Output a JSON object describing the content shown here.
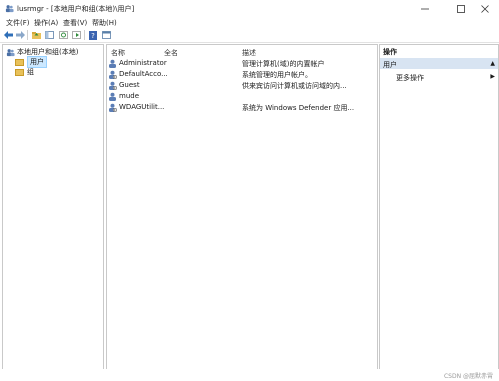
{
  "window": {
    "title": "lusrmgr - [本地用户和组(本地)\\用户]",
    "app_icon": "user-group-icon",
    "min_icon": "minimize-icon",
    "max_icon": "maximize-icon",
    "close_icon": "close-icon"
  },
  "menu": {
    "items": [
      {
        "label": "文件(F)"
      },
      {
        "label": "操作(A)"
      },
      {
        "label": "查看(V)"
      },
      {
        "label": "帮助(H)"
      }
    ]
  },
  "toolbar": {
    "buttons": [
      "back-icon",
      "forward-icon",
      "up-folder-icon",
      "show-hide-tree-icon",
      "refresh-icon",
      "export-list-icon",
      "help-icon",
      "properties-icon"
    ]
  },
  "tree": {
    "root": "本地用户和组(本地)",
    "children": [
      {
        "label": "用户",
        "selected": true
      },
      {
        "label": "组",
        "selected": false
      }
    ]
  },
  "list": {
    "columns": {
      "name": "名称",
      "fullname": "全名",
      "description": "描述"
    },
    "rows": [
      {
        "name": "Administrator",
        "description": "管理计算机(域)的内置帐户"
      },
      {
        "name": "DefaultAcco...",
        "description": "系统管理的用户帐户。"
      },
      {
        "name": "Guest",
        "description": "供来宾访问计算机或访问域的内..."
      },
      {
        "name": "mude",
        "description": ""
      },
      {
        "name": "WDAGUtilit...",
        "description": "系统为 Windows Defender 应用..."
      }
    ]
  },
  "actions": {
    "title": "操作",
    "section": "用户",
    "more": "更多操作"
  },
  "status": {
    "watermark": "CSDN @屈默赤霄"
  }
}
